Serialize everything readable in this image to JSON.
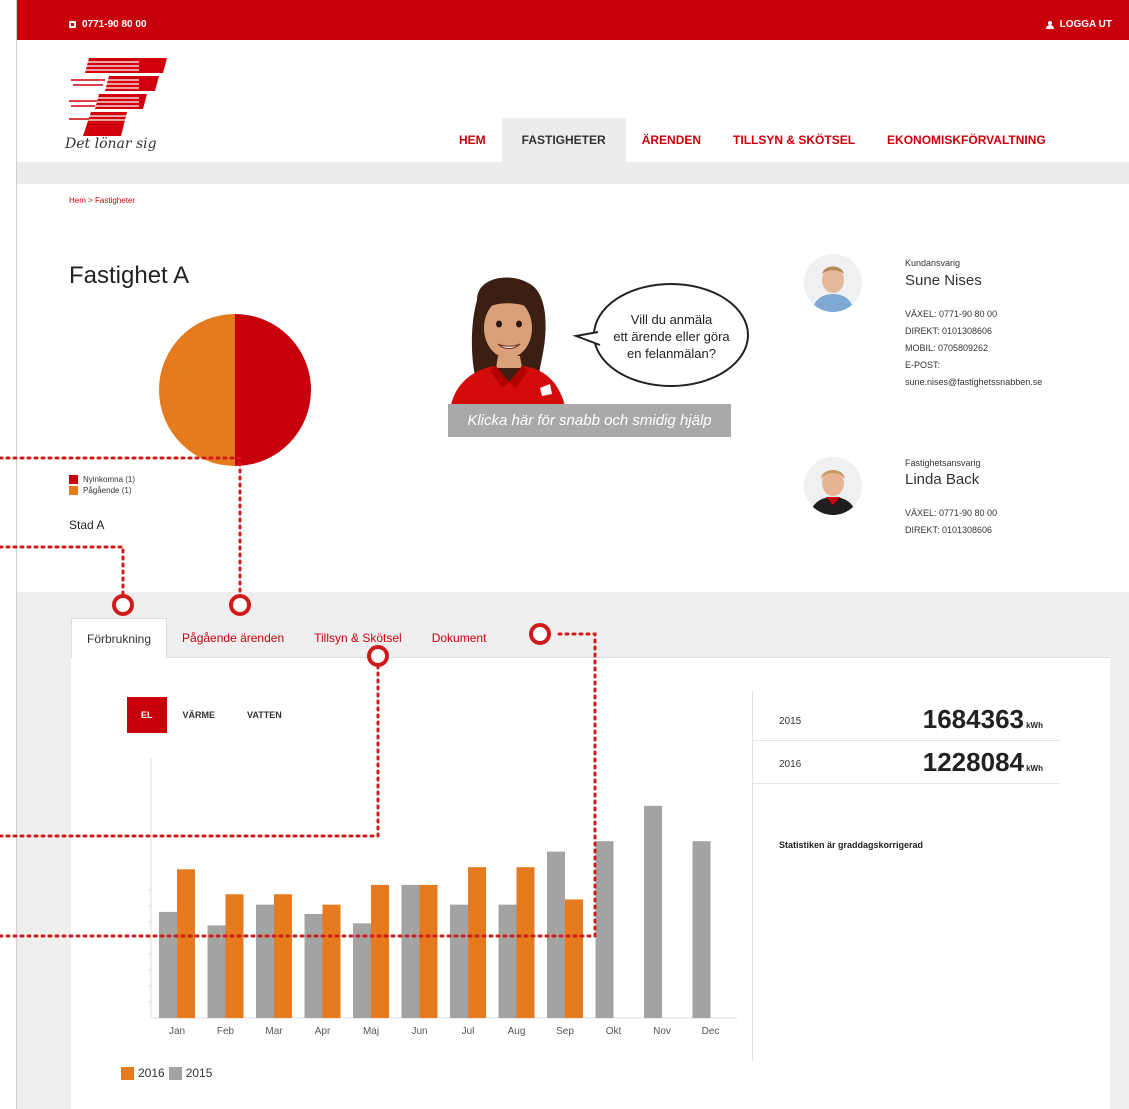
{
  "topbar": {
    "phone": "0771-90 80 00",
    "logout": "LOGGA UT"
  },
  "header": {
    "slogan": "Det lönar sig",
    "nav": [
      "HEM",
      "FASTIGHETER",
      "ÄRENDEN",
      "TILLSYN & SKÖTSEL",
      "EKONOMISKFÖRVALTNING"
    ],
    "active_nav": "FASTIGHETER"
  },
  "breadcrumb": "Hem > Fastigheter",
  "property": {
    "title": "Fastighet A",
    "city": "Stad A",
    "pie": {
      "slices": [
        {
          "label": "Nyinkomna (1)",
          "value": 1,
          "color": "#c8000c"
        },
        {
          "label": "Pågående (1)",
          "value": 1,
          "color": "#e57a1f"
        }
      ]
    }
  },
  "helper": {
    "bubble": [
      "Vill du anmäla",
      "ett ärende eller göra",
      "en felanmälan?"
    ],
    "button": "Klicka här för snabb och smidig hjälp"
  },
  "contacts": [
    {
      "role": "Kundansvarig",
      "name": "Sune Nises",
      "lines": [
        "VÄXEL: 0771-90 80 00",
        "DIREKT: 0101308606",
        "MOBIL: 0705809262",
        "E-POST:",
        "sune.nises@fastighetssnabben.se"
      ]
    },
    {
      "role": "Fastighetsansvarig",
      "name": "Linda Back",
      "lines": [
        "VÄXEL: 0771-90 80 00",
        "DIREKT: 0101308606"
      ]
    }
  ],
  "tabs": [
    "Förbrukning",
    "Pågående ärenden",
    "Tillsyn & Skötsel",
    "Dokument"
  ],
  "active_tab": "Förbrukning",
  "energy_tabs": [
    "EL",
    "VÄRME",
    "VATTEN"
  ],
  "active_energy_tab": "EL",
  "stats": [
    {
      "year": "2015",
      "value": "1684363",
      "unit": "kWh"
    },
    {
      "year": "2016",
      "value": "1228084",
      "unit": "kWh"
    }
  ],
  "stats_note": "Statistiken är graddagskorrigerad",
  "colors": {
    "brand_red": "#c8000c",
    "orange": "#e57a1f",
    "gray_bar": "#a3a3a3"
  },
  "chart_data": {
    "type": "bar",
    "categories": [
      "Jan",
      "Feb",
      "Mar",
      "Apr",
      "Maj",
      "Jun",
      "Jul",
      "Aug",
      "Sep",
      "Okt",
      "Nov",
      "Dec"
    ],
    "series": [
      {
        "name": "2015",
        "color": "#a3a3a3",
        "values": [
          102,
          89,
          109,
          100,
          91,
          128,
          109,
          109,
          160,
          170,
          204,
          170
        ]
      },
      {
        "name": "2016",
        "color": "#e57a1f",
        "values": [
          143,
          119,
          119,
          109,
          128,
          128,
          145,
          145,
          114,
          null,
          null,
          null
        ]
      }
    ],
    "ylim": [
      0,
      250
    ],
    "grid": false,
    "legend_position": "bottom-left"
  }
}
